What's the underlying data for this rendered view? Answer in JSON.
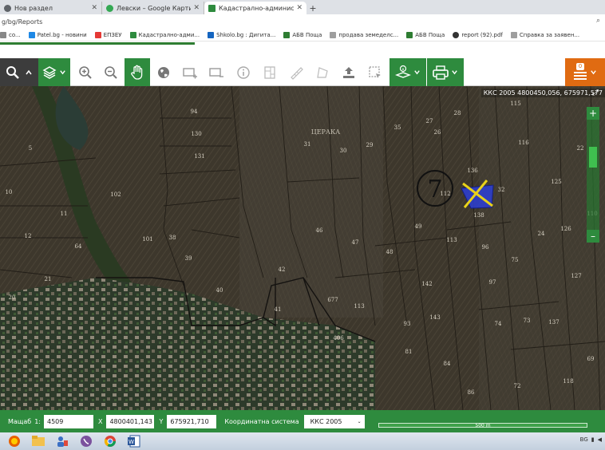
{
  "browser": {
    "tabs": [
      {
        "label": "Нов раздел",
        "active": false,
        "icon_color": "#5f6368"
      },
      {
        "label": "Левски – Google Карти",
        "active": false,
        "icon_color": "#34a853"
      },
      {
        "label": "Кадастрално-административна",
        "active": true,
        "icon_color": "#2e8b3e"
      }
    ],
    "url": "g/bg/Reports",
    "bookmarks": [
      {
        "label": "co...",
        "color": "#888"
      },
      {
        "label": "Patel.bg - новини",
        "color": "#1e88e5"
      },
      {
        "label": "ЕПЗЕУ",
        "color": "#e53935"
      },
      {
        "label": "Кадастрално-адми...",
        "color": "#2e8b3e"
      },
      {
        "label": "Shkolo.bg : Дигита...",
        "color": "#1565c0"
      },
      {
        "label": "АБВ Поща",
        "color": "#2e7d32"
      },
      {
        "label": "продава земеделс...",
        "color": "#9e9e9e"
      },
      {
        "label": "АБВ Поща",
        "color": "#2e7d32"
      },
      {
        "label": "report (92).pdf",
        "color": "#333"
      },
      {
        "label": "Справка за заявен...",
        "color": "#9e9e9e"
      }
    ]
  },
  "toolbar": {
    "menu_count": "0"
  },
  "map": {
    "coord_readout": "ККС 2005 4800450,056, 675971,577",
    "place_label": "ЦЕРАКА",
    "parcel_labels": [
      {
        "text": "94"
      },
      {
        "text": "130"
      },
      {
        "text": "131"
      },
      {
        "text": "5"
      },
      {
        "text": "10"
      },
      {
        "text": "11"
      },
      {
        "text": "12"
      },
      {
        "text": "21"
      },
      {
        "text": "20"
      },
      {
        "text": "102"
      },
      {
        "text": "101"
      },
      {
        "text": "64"
      },
      {
        "text": "38"
      },
      {
        "text": "39"
      },
      {
        "text": "40"
      },
      {
        "text": "31"
      },
      {
        "text": "30"
      },
      {
        "text": "29"
      },
      {
        "text": "35"
      },
      {
        "text": "46"
      },
      {
        "text": "47"
      },
      {
        "text": "48"
      },
      {
        "text": "42"
      },
      {
        "text": "41"
      },
      {
        "text": "677"
      },
      {
        "text": "113"
      },
      {
        "text": "406"
      },
      {
        "text": "93"
      },
      {
        "text": "28"
      },
      {
        "text": "27"
      },
      {
        "text": "26"
      },
      {
        "text": "115"
      },
      {
        "text": "116"
      },
      {
        "text": "22"
      },
      {
        "text": "136"
      },
      {
        "text": "112"
      },
      {
        "text": "32"
      },
      {
        "text": "138"
      },
      {
        "text": "125"
      },
      {
        "text": "49"
      },
      {
        "text": "113"
      },
      {
        "text": "96"
      },
      {
        "text": "24"
      },
      {
        "text": "126"
      },
      {
        "text": "75"
      },
      {
        "text": "127"
      },
      {
        "text": "142"
      },
      {
        "text": "97"
      },
      {
        "text": "143"
      },
      {
        "text": "74"
      },
      {
        "text": "73"
      },
      {
        "text": "137"
      },
      {
        "text": "81"
      },
      {
        "text": "84"
      },
      {
        "text": "86"
      },
      {
        "text": "72"
      },
      {
        "text": "118"
      },
      {
        "text": "69"
      },
      {
        "text": "110"
      }
    ],
    "annotation_number": "7",
    "marker_color": "#e8d21a",
    "selected_fill": "#2c3fd6"
  },
  "status": {
    "scale_label": "Мащаб",
    "scale_prefix": "1:",
    "scale_value": "4509",
    "x_label": "X",
    "x_value": "4800401,143",
    "y_label": "Y",
    "y_value": "675921,710",
    "crs_label": "Координатна система",
    "crs_value": "ККС 2005",
    "scalebar": "500 m"
  },
  "taskbar": {
    "tray_lang": "BG"
  }
}
